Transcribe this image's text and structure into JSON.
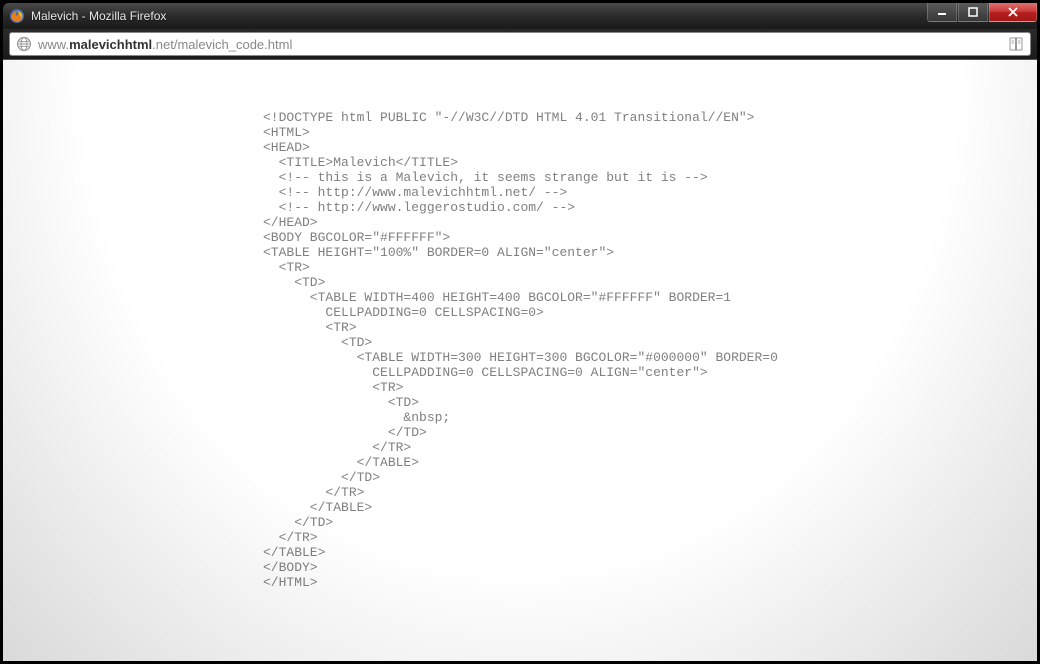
{
  "window": {
    "title": "Malevich - Mozilla Firefox"
  },
  "address": {
    "prefix": "www.",
    "domain": "malevichhtml",
    "suffix": ".net/malevich_code.html"
  },
  "code": {
    "line1": "<!DOCTYPE html PUBLIC \"-//W3C//DTD HTML 4.01 Transitional//EN\">",
    "line2": "<HTML>",
    "line3": "<HEAD>",
    "line4": "  <TITLE>Malevich</TITLE>",
    "line5": "  <!-- this is a Malevich, it seems strange but it is -->",
    "line6": "  <!-- http://www.malevichhtml.net/ -->",
    "line7": "  <!-- http://www.leggerostudio.com/ -->",
    "line8": "</HEAD>",
    "line9": "<BODY BGCOLOR=\"#FFFFFF\">",
    "line10": "<TABLE HEIGHT=\"100%\" BORDER=0 ALIGN=\"center\">",
    "line11": "  <TR>",
    "line12": "    <TD>",
    "line13": "      <TABLE WIDTH=400 HEIGHT=400 BGCOLOR=\"#FFFFFF\" BORDER=1",
    "line14": "        CELLPADDING=0 CELLSPACING=0>",
    "line15": "        <TR>",
    "line16": "          <TD>",
    "line17": "            <TABLE WIDTH=300 HEIGHT=300 BGCOLOR=\"#000000\" BORDER=0",
    "line18": "              CELLPADDING=0 CELLSPACING=0 ALIGN=\"center\">",
    "line19": "              <TR>",
    "line20": "                <TD>",
    "line21": "                  &nbsp;",
    "line22": "                </TD>",
    "line23": "              </TR>",
    "line24": "            </TABLE>",
    "line25": "          </TD>",
    "line26": "        </TR>",
    "line27": "      </TABLE>",
    "line28": "    </TD>",
    "line29": "  </TR>",
    "line30": "</TABLE>",
    "line31": "</BODY>",
    "line32": "</HTML>"
  }
}
